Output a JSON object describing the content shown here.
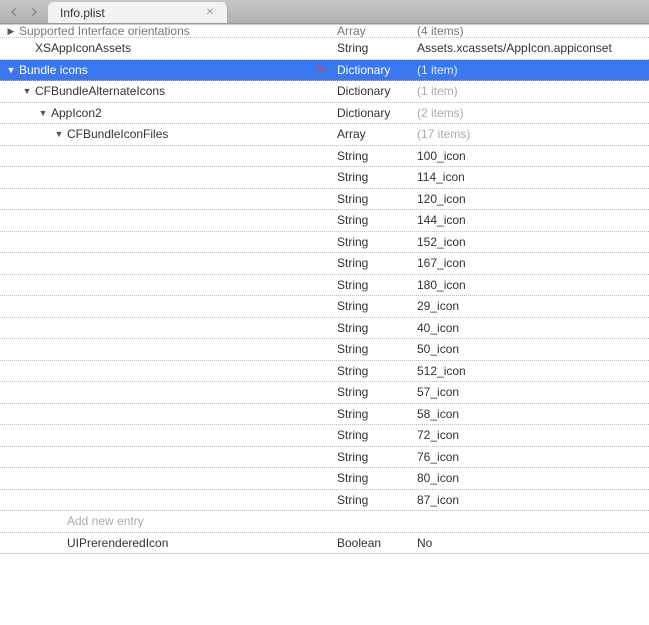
{
  "tab": {
    "title": "Info.plist"
  },
  "top_cutoff": {
    "key_top": "Supported Interface orientations",
    "type_top": "Array",
    "value_top": "(4 items)"
  },
  "rows": [
    {
      "indent": 1,
      "key": "XSAppIconAssets",
      "type": "String",
      "value": "Assets.xcassets/AppIcon.appiconset",
      "arrow": false
    },
    {
      "indent": 0,
      "key": "Bundle icons",
      "type": "Dictionary",
      "value": "(1 item)",
      "arrow": true,
      "selected": true,
      "show_delete": true
    },
    {
      "indent": 1,
      "key": "CFBundleAlternateIcons",
      "type": "Dictionary",
      "value": "(1 item)",
      "arrow": true
    },
    {
      "indent": 2,
      "key": "AppIcon2",
      "type": "Dictionary",
      "value": "(2 items)",
      "arrow": true
    },
    {
      "indent": 3,
      "key": "CFBundleIconFiles",
      "type": "Array",
      "value": "(17 items)",
      "arrow": true
    },
    {
      "indent": 4,
      "key": "",
      "type": "String",
      "value": "100_icon"
    },
    {
      "indent": 4,
      "key": "",
      "type": "String",
      "value": "114_icon"
    },
    {
      "indent": 4,
      "key": "",
      "type": "String",
      "value": "120_icon"
    },
    {
      "indent": 4,
      "key": "",
      "type": "String",
      "value": "144_icon"
    },
    {
      "indent": 4,
      "key": "",
      "type": "String",
      "value": "152_icon"
    },
    {
      "indent": 4,
      "key": "",
      "type": "String",
      "value": "167_icon"
    },
    {
      "indent": 4,
      "key": "",
      "type": "String",
      "value": "180_icon"
    },
    {
      "indent": 4,
      "key": "",
      "type": "String",
      "value": "29_icon"
    },
    {
      "indent": 4,
      "key": "",
      "type": "String",
      "value": "40_icon"
    },
    {
      "indent": 4,
      "key": "",
      "type": "String",
      "value": "50_icon"
    },
    {
      "indent": 4,
      "key": "",
      "type": "String",
      "value": "512_icon"
    },
    {
      "indent": 4,
      "key": "",
      "type": "String",
      "value": "57_icon"
    },
    {
      "indent": 4,
      "key": "",
      "type": "String",
      "value": "58_icon"
    },
    {
      "indent": 4,
      "key": "",
      "type": "String",
      "value": "72_icon"
    },
    {
      "indent": 4,
      "key": "",
      "type": "String",
      "value": "76_icon"
    },
    {
      "indent": 4,
      "key": "",
      "type": "String",
      "value": "80_icon"
    },
    {
      "indent": 4,
      "key": "",
      "type": "String",
      "value": "87_icon"
    },
    {
      "indent": 3,
      "key": "Add new entry",
      "type": "",
      "value": "",
      "placeholder": true
    },
    {
      "indent": 3,
      "key": "UIPrerenderedIcon",
      "type": "Boolean",
      "value": "No",
      "solid": true
    }
  ]
}
